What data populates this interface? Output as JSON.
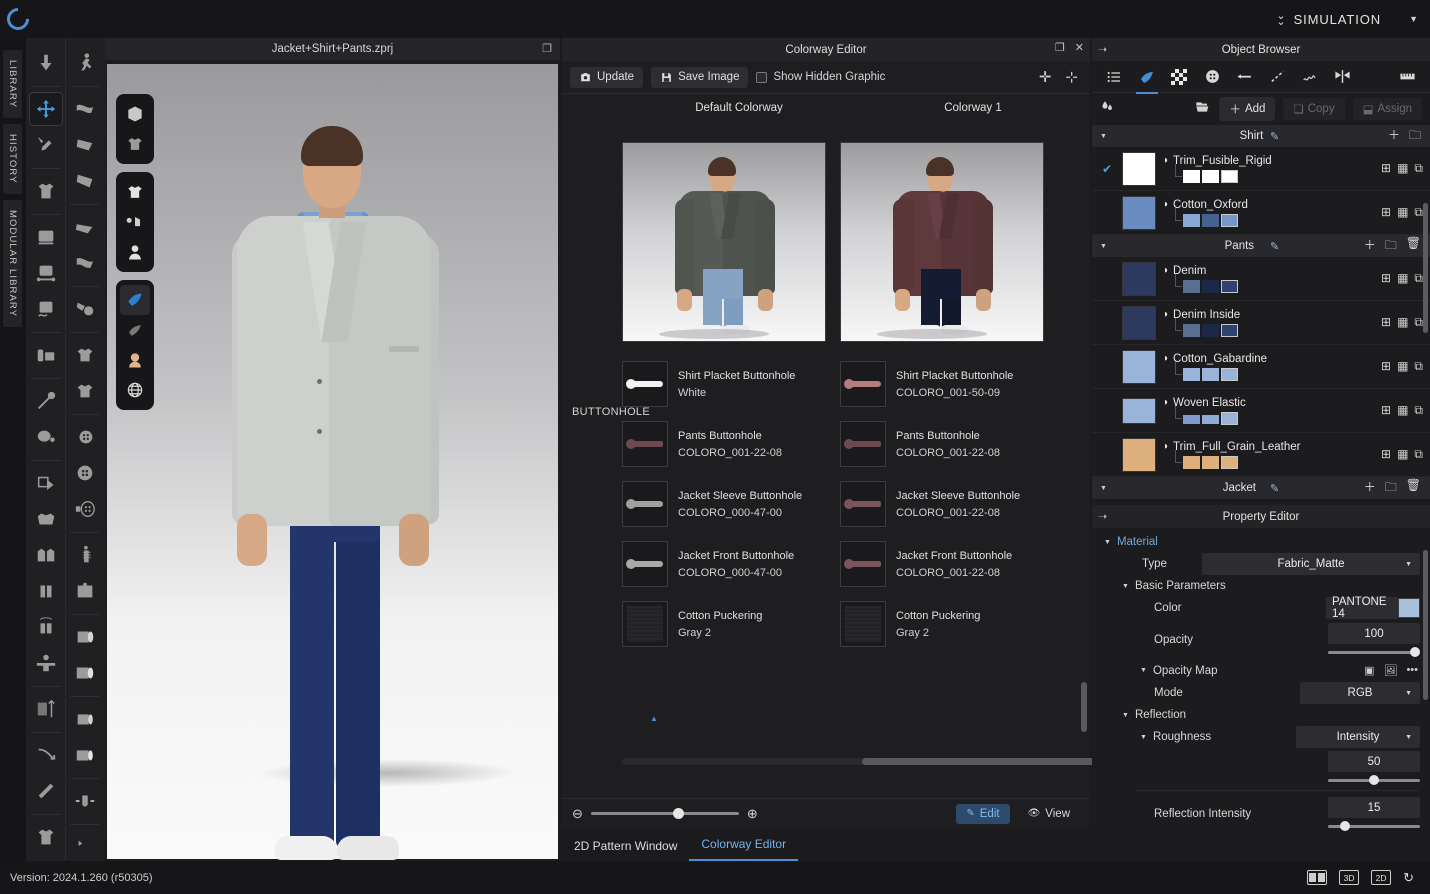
{
  "app": {
    "version": "Version: 2024.1.260 (r50305)",
    "simulation_label": "SIMULATION",
    "logo": "clo-logo"
  },
  "left_tabs": [
    {
      "label": "LIBRARY"
    },
    {
      "label": "HISTORY"
    },
    {
      "label": "MODULAR LIBRARY"
    }
  ],
  "viewport": {
    "title": "Jacket+Shirt+Pants.zprj"
  },
  "colorway_editor": {
    "title": "Colorway Editor",
    "toolbar": {
      "update": "Update",
      "save_image": "Save Image",
      "show_hidden_graphic": "Show Hidden Graphic"
    },
    "columns": [
      "Default Colorway",
      "Colorway 1"
    ],
    "group_label": "BUTTONHOLE",
    "rows": [
      {
        "default": {
          "name": "Shirt Placket Buttonhole",
          "value": "White",
          "color": "#f2f2f2",
          "style": "hole"
        },
        "colorway1": {
          "name": "Shirt Placket Buttonhole",
          "value": "COLORO_001-50-09",
          "color": "#b37d80",
          "style": "hole"
        }
      },
      {
        "default": {
          "name": "Pants Buttonhole",
          "value": "COLORO_001-22-08",
          "color": "#6e4a50",
          "style": "flat"
        },
        "colorway1": {
          "name": "Pants Buttonhole",
          "value": "COLORO_001-22-08",
          "color": "#6e4a50",
          "style": "flat"
        }
      },
      {
        "default": {
          "name": "Jacket Sleeve Buttonhole",
          "value": "COLORO_000-47-00",
          "color": "#a0a0a0",
          "style": "hole"
        },
        "colorway1": {
          "name": "Jacket Sleeve Buttonhole",
          "value": "COLORO_001-22-08",
          "color": "#7a555b",
          "style": "flat"
        }
      },
      {
        "default": {
          "name": "Jacket Front Buttonhole",
          "value": "COLORO_000-47-00",
          "color": "#a8a8a8",
          "style": "hole"
        },
        "colorway1": {
          "name": "Jacket Front Buttonhole",
          "value": "COLORO_001-22-08",
          "color": "#7a555b",
          "style": "flat"
        }
      },
      {
        "default": {
          "name": "Cotton Puckering",
          "value": "Gray 2",
          "color": "#2b2b2d",
          "style": "puckering"
        },
        "colorway1": {
          "name": "Cotton Puckering",
          "value": "Gray 2",
          "color": "#2b2b2d",
          "style": "puckering"
        }
      }
    ],
    "footer": {
      "edit": "Edit",
      "view": "View"
    },
    "tabs": [
      {
        "label": "2D Pattern Window",
        "selected": false
      },
      {
        "label": "Colorway Editor",
        "selected": true
      }
    ]
  },
  "object_browser": {
    "title": "Object Browser",
    "tabs": [
      "list-icon",
      "fabric-icon",
      "checker-icon",
      "button-icon",
      "elastic-icon",
      "topstitch-icon",
      "stitch-icon",
      "symmetry-icon",
      "fold-icon",
      "ruler-icon"
    ],
    "selected_tab_index": 1,
    "actions": {
      "add": "Add",
      "copy": "Copy",
      "assign": "Assign"
    },
    "groups": [
      {
        "name": "Shirt",
        "materials": [
          {
            "name": "Trim_Fusible_Rigid",
            "checked": true,
            "swatch": "#ffffff",
            "chips": [
              "#ffffff",
              "#ffffff",
              "#ffffff"
            ],
            "selected_chip": 2
          },
          {
            "name": "Cotton_Oxford",
            "checked": false,
            "swatch": "#6a8bc0",
            "chips": [
              "#8aa8d4",
              "#44618f",
              "#7797c8"
            ],
            "selected_chip": 2
          }
        ]
      },
      {
        "name": "Pants",
        "materials": [
          {
            "name": "Denim",
            "checked": false,
            "swatch": "#2b3a5e",
            "chips": [
              "#5a6f90",
              "#1c2848",
              "#2f4272"
            ],
            "selected_chip": 2
          },
          {
            "name": "Denim Inside",
            "checked": false,
            "swatch": "#2b3a5e",
            "chips": [
              "#5a6f90",
              "#1c2848",
              "#2f4272"
            ],
            "selected_chip": 2
          },
          {
            "name": "Cotton_Gabardine",
            "checked": false,
            "swatch": "#9ab4d9",
            "chips": [
              "#9ab4d9",
              "#9ab4d9",
              "#9ab4d9"
            ],
            "selected_chip": 2
          },
          {
            "name": "Woven Elastic",
            "checked": false,
            "swatch": "#9ab4d9",
            "chips": [
              "#7e9bcc",
              "#8fabd4",
              "#9ab4d9"
            ],
            "selected_chip": 2
          },
          {
            "name": "Trim_Full_Grain_Leather",
            "checked": false,
            "swatch": "#ddb07c",
            "chips": [
              "#ddb07c",
              "#ddb07c",
              "#ddb07c"
            ],
            "selected_chip": 2
          }
        ]
      },
      {
        "name": "Jacket",
        "materials": []
      }
    ]
  },
  "property_editor": {
    "title": "Property Editor",
    "material_section": "Material",
    "type_label": "Type",
    "type_value": "Fabric_Matte",
    "basic_parameters": "Basic Parameters",
    "color_label": "Color",
    "color_value": "PANTONE 14",
    "color_swatch": "#a9c0dc",
    "opacity_label": "Opacity",
    "opacity_value": "100",
    "opacity_map": "Opacity Map",
    "mode_label": "Mode",
    "mode_value": "RGB",
    "reflection": "Reflection",
    "roughness_label": "Roughness",
    "roughness_type": "Intensity",
    "roughness_value": "50",
    "reflection_intensity_label": "Reflection Intensity",
    "reflection_intensity_value": "15"
  },
  "status_bar": {
    "view_3d": "3D",
    "view_2d": "2D"
  }
}
